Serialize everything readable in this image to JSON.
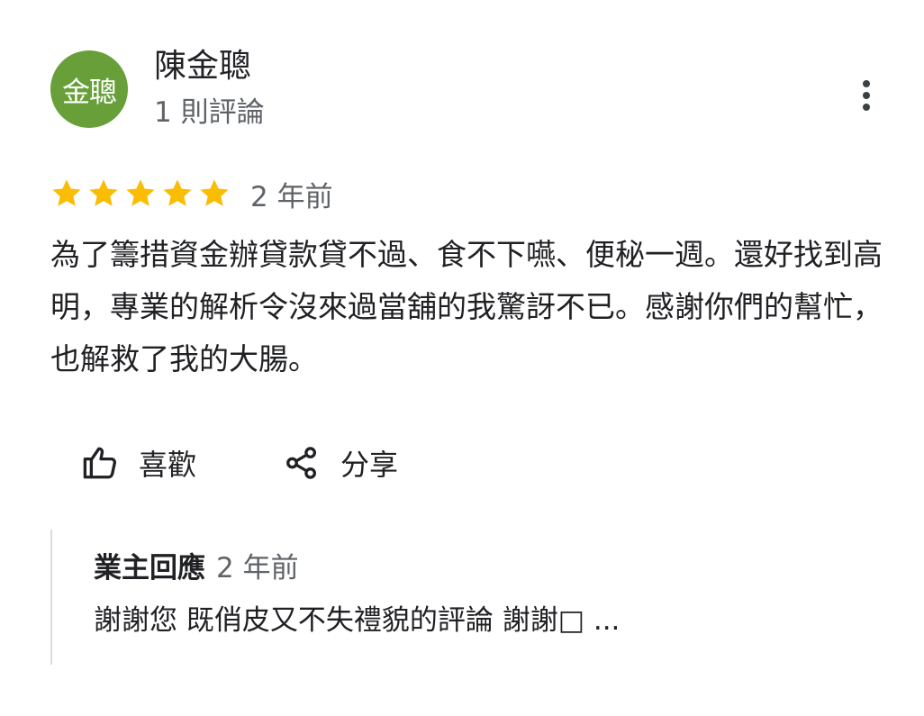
{
  "reviewer": {
    "avatar_text": "金聰",
    "avatar_color": "#689f38",
    "name": "陳金聰",
    "review_count": "1 則評論"
  },
  "menu": {
    "icon": "more-vert-icon"
  },
  "review": {
    "rating": 5,
    "max_rating": 5,
    "star_color": "#fbbc04",
    "time": "2 年前",
    "text": "為了籌措資金辦貸款貸不過、食不下嚥、便秘一週。還好找到高明，專業的解析令沒來過當舖的我驚訝不已。感謝你們的幫忙，也解救了我的大腸。"
  },
  "actions": {
    "like_icon": "thumb-up-icon",
    "like_label": "喜歡",
    "share_icon": "share-icon",
    "share_label": "分享"
  },
  "owner_response": {
    "label": "業主回應",
    "time": "2 年前",
    "text": "謝謝您 既俏皮又不失禮貌的評論 謝謝□ ..."
  }
}
